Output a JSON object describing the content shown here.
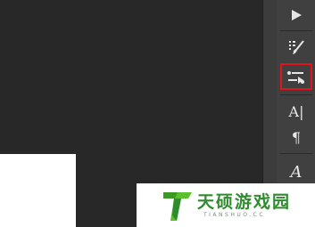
{
  "panel": {
    "tools": [
      {
        "icon": "play-icon"
      },
      {
        "icon": "brush-settings-icon"
      },
      {
        "icon": "clone-source-icon",
        "highlighted": true
      },
      {
        "icon": "character-icon",
        "label": "A|"
      },
      {
        "icon": "paragraph-icon",
        "label": "¶"
      },
      {
        "icon": "glyphs-icon",
        "label": "A"
      }
    ],
    "highlight_color": "#e1141d"
  },
  "watermark": {
    "name": "天硕游戏园",
    "url": "TIANSHUO.CC",
    "brand_color": "#2e8b2e"
  }
}
